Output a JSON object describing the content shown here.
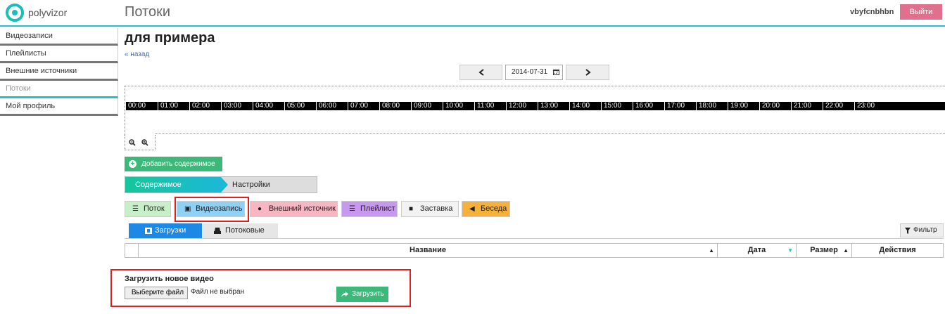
{
  "header": {
    "logo_text": "polyvizor",
    "page_title": "Потоки",
    "username": "vbyfcnbhbn",
    "logout_label": "Выйти"
  },
  "sidebar": {
    "items": [
      {
        "label": "Видеозаписи"
      },
      {
        "label": "Плейлисты"
      },
      {
        "label": "Внешние источники"
      },
      {
        "label": "Потоки",
        "active": true
      },
      {
        "label": "Мой профиль"
      }
    ]
  },
  "main": {
    "title": "для примера",
    "back_label": "« назад",
    "date_value": "2014-07-31",
    "hours": [
      "00:00",
      "01:00",
      "02:00",
      "03:00",
      "04:00",
      "05:00",
      "06:00",
      "07:00",
      "08:00",
      "09:00",
      "10:00",
      "11:00",
      "12:00",
      "13:00",
      "14:00",
      "15:00",
      "16:00",
      "17:00",
      "18:00",
      "19:00",
      "20:00",
      "21:00",
      "22:00",
      "23:00"
    ],
    "add_content_label": "Добавить содержимое",
    "wizard": {
      "step1": "Содержимое",
      "step2": "Настройки"
    },
    "type_buttons": [
      {
        "label": "Поток",
        "icon": "list-icon",
        "color": "#c8f0c8"
      },
      {
        "label": "Видеозапись",
        "icon": "film-icon",
        "color": "#8fd0f5",
        "selected": true
      },
      {
        "label": "Внешний источник",
        "icon": "globe-icon",
        "color": "#f7b6c2"
      },
      {
        "label": "Плейлист",
        "icon": "list-icon",
        "color": "#c897f0"
      },
      {
        "label": "Заставка",
        "icon": "file-icon",
        "color": "#f2f2f2"
      },
      {
        "label": "Беседа",
        "icon": "megaphone-icon",
        "color": "#f6b13a"
      }
    ],
    "tabs": [
      {
        "label": "Загрузки",
        "active": true
      },
      {
        "label": "Потоковые"
      }
    ],
    "filter_label": "Фильтр",
    "table_columns": [
      "Название",
      "Дата",
      "Размер",
      "Действия"
    ],
    "upload": {
      "title": "Загрузить новое видео",
      "choose_file_label": "Выберите файл",
      "file_status": "Файл не выбран",
      "upload_label": "Загрузить"
    }
  },
  "colors": {
    "accent": "#1ec3c9",
    "green": "#3cb878",
    "logout": "#e0708c",
    "highlight": "#e02020",
    "tab_blue": "#1e88e5"
  }
}
